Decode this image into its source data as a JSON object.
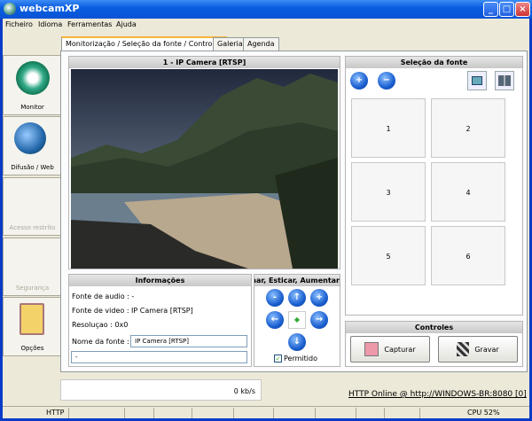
{
  "window": {
    "title": "webcamXP"
  },
  "menu": [
    "Ficheiro",
    "Idioma",
    "Ferramentas",
    "Ajuda"
  ],
  "sidebar": [
    {
      "label": "Monitor",
      "enabled": true,
      "icon": "monitor-eye-icon"
    },
    {
      "label": "Difusão / Web",
      "enabled": true,
      "icon": "globe-computer-icon"
    },
    {
      "label": "Acesso restrito",
      "enabled": false
    },
    {
      "label": "Segurança",
      "enabled": false
    },
    {
      "label": "Opções",
      "enabled": true,
      "icon": "clipboard-options-icon"
    }
  ],
  "tabs": [
    "Monitorização / Seleção da fonte / Controles",
    "Galeria",
    "Agenda"
  ],
  "camera": {
    "title": "1 - IP Camera [RTSP]"
  },
  "info": {
    "title": "Informações",
    "audio": "Fonte de audio : -",
    "video": "Fonte de video : IP Camera [RTSP]",
    "resolution": "Resoluçao : 0x0",
    "name_label": "Nome da fonte :",
    "name_value": "IP Camera [RTSP]",
    "extra_value": "-"
  },
  "ptz": {
    "title": "Aproximar, Esticar, Aumentar",
    "permitted_label": "Permitido",
    "permitted": true
  },
  "sources": {
    "title": "Seleção da fonte",
    "cells": [
      "1",
      "2",
      "3",
      "4",
      "5",
      "6"
    ]
  },
  "controls": {
    "title": "Controles",
    "capture": "Capturar",
    "record": "Gravar"
  },
  "bandwidth": "0 kb/s",
  "http_link": "HTTP Online @ http://WINDOWS-BR:8080 [0]",
  "statusbar": {
    "mode": "HTTP",
    "cpu": "CPU 52%"
  }
}
